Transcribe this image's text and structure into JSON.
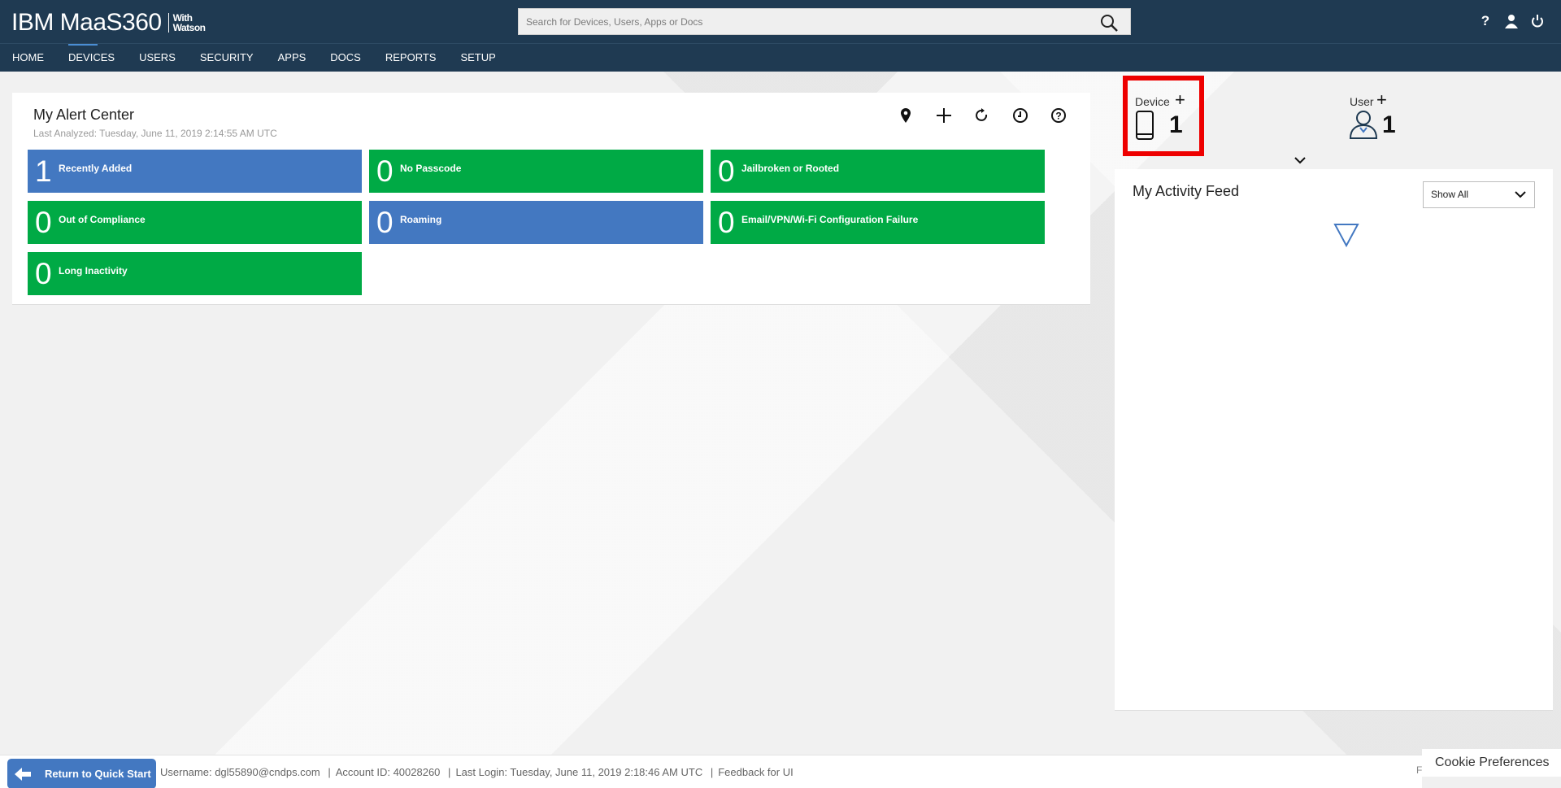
{
  "header": {
    "logo_text": "IBM MaaS360",
    "logo_with": "With",
    "logo_watson": "Watson",
    "search_placeholder": "Search for Devices, Users, Apps or Docs",
    "help_icon": "question-icon",
    "user_icon": "person-icon",
    "power_icon": "power-icon"
  },
  "nav": {
    "items": [
      "HOME",
      "DEVICES",
      "USERS",
      "SECURITY",
      "APPS",
      "DOCS",
      "REPORTS",
      "SETUP"
    ],
    "active": "DEVICES"
  },
  "alert_center": {
    "title": "My Alert Center",
    "last_analyzed": "Last Analyzed: Tuesday, June 11, 2019 2:14:55 AM UTC",
    "tools": [
      "location-pin-icon",
      "plus-icon",
      "refresh-icon",
      "clock-icon",
      "help-circle-icon"
    ],
    "tiles": [
      {
        "count": "1",
        "label": "Recently Added",
        "color": "#4378c1"
      },
      {
        "count": "0",
        "label": "No Passcode",
        "color": "#00aa45"
      },
      {
        "count": "0",
        "label": "Jailbroken or Rooted",
        "color": "#00aa45"
      },
      {
        "count": "0",
        "label": "Out of Compliance",
        "color": "#00aa45"
      },
      {
        "count": "0",
        "label": "Roaming",
        "color": "#4378c1"
      },
      {
        "count": "0",
        "label": "Email/VPN/Wi-Fi Configuration Failure",
        "color": "#00aa45"
      },
      {
        "count": "0",
        "label": "Long Inactivity",
        "color": "#00aa45"
      }
    ]
  },
  "summary": {
    "device_label": "Device",
    "device_count": "1",
    "user_label": "User",
    "user_count": "1",
    "highlight_color": "#ee0000"
  },
  "activity_feed": {
    "title": "My Activity Feed",
    "filter_value": "Show All"
  },
  "footer": {
    "quick_start": "Return to Quick Start",
    "username": "Username:  dgl55890@cndps.com",
    "account": "Account ID:  40028260",
    "last_login": "Last Login: Tuesday, June 11, 2019 2:18:46 AM UTC",
    "feedback": "Feedback for UI",
    "truncated": "F",
    "cookie": "Cookie Preferences"
  },
  "colors": {
    "header_bg": "#1f3a52",
    "tile_green": "#00aa45",
    "tile_blue": "#4378c1",
    "accent": "#4a8ed4"
  }
}
